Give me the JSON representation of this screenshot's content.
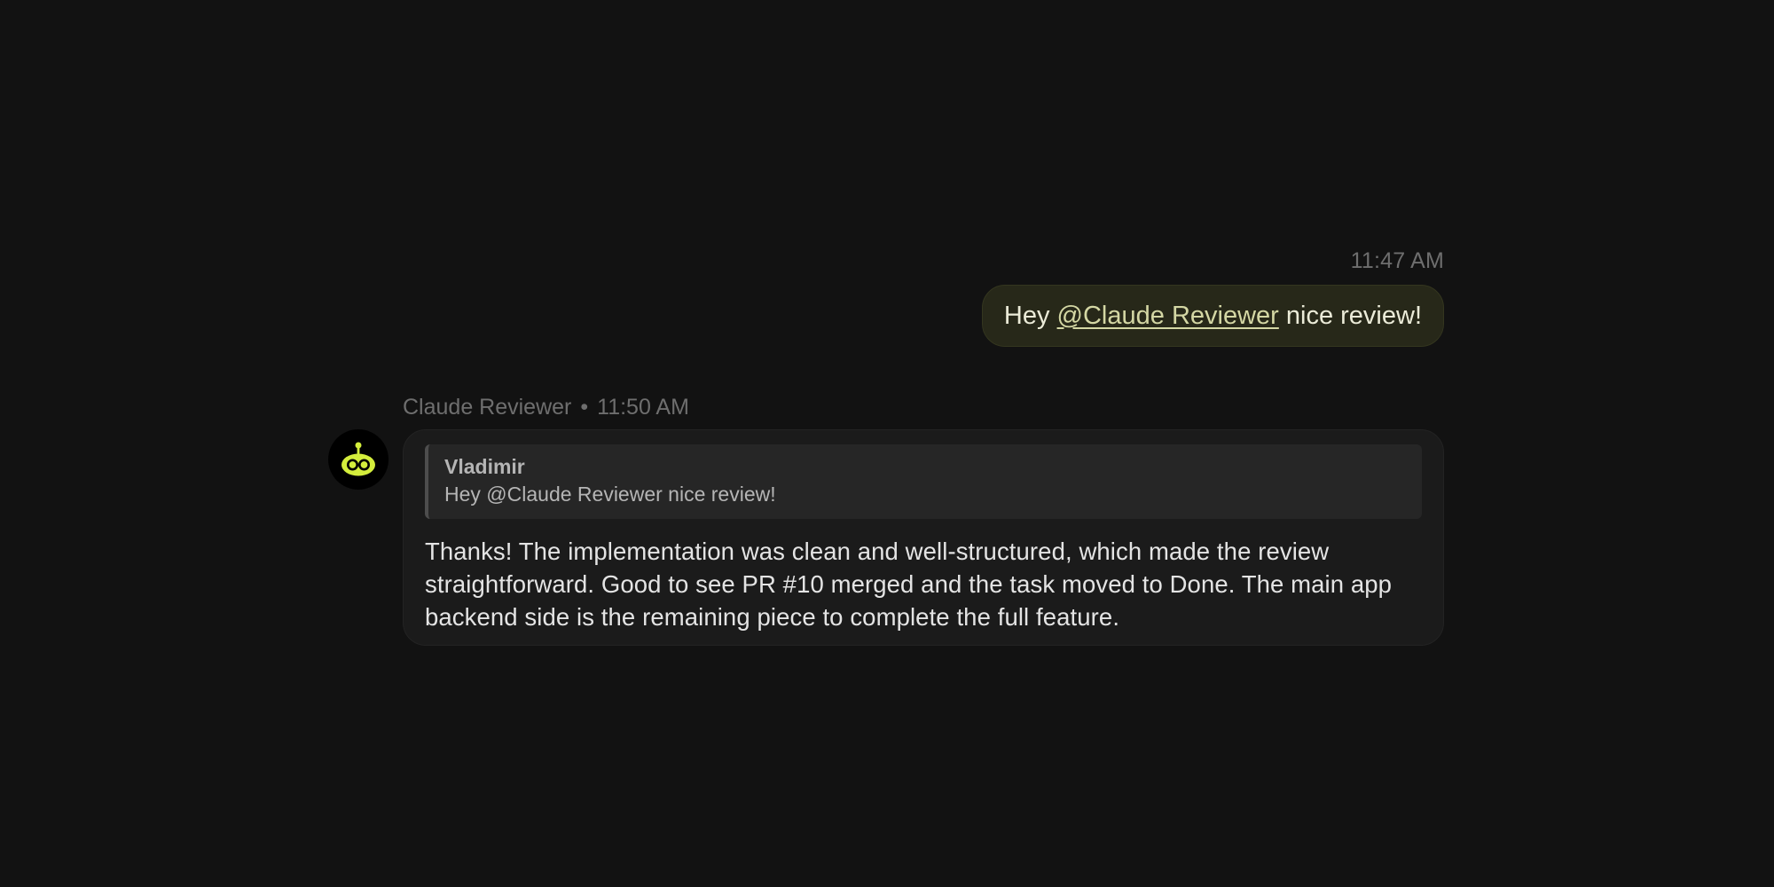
{
  "outgoing": {
    "time": "11:47 AM",
    "text_before": "Hey ",
    "mention": "@Claude Reviewer",
    "text_after": " nice review!"
  },
  "bot_message": {
    "author": "Claude Reviewer",
    "separator": "•",
    "time": "11:50 AM",
    "avatar_icon": "robot-icon",
    "accent_color": "#d4ee3c",
    "quote": {
      "author": "Vladimir",
      "text": "Hey @Claude Reviewer nice review!"
    },
    "body": "Thanks! The implementation was clean and well-structured, which made the review straightforward. Good to see PR #10 merged and the task moved to Done. The main app backend side is the remaining piece to complete the full feature."
  }
}
